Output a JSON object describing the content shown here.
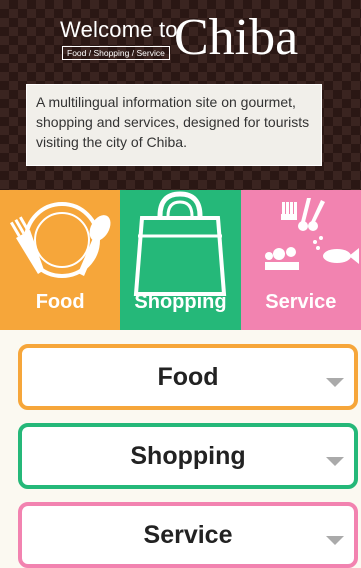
{
  "header": {
    "welcome": "Welcome to",
    "tagline": "Food / Shopping / Service",
    "brand": "Chiba",
    "intro": "A multilingual information site on gourmet, shopping and services, designed for tourists visiting the city of Chiba."
  },
  "tiles": [
    {
      "label": "Food",
      "icon": "plate-fork-spoon-icon",
      "color": "#f6a63a"
    },
    {
      "label": "Shopping",
      "icon": "shopping-bag-icon",
      "color": "#25b879"
    },
    {
      "label": "Service",
      "icon": "services-icon",
      "color": "#f283b0"
    }
  ],
  "accordions": [
    {
      "label": "Food",
      "color": "#f6a63a"
    },
    {
      "label": "Shopping",
      "color": "#25b879"
    },
    {
      "label": "Service",
      "color": "#f283b0"
    }
  ],
  "colors": {
    "header_bg": "#3a2420",
    "page_bg": "#fbf9f1"
  }
}
